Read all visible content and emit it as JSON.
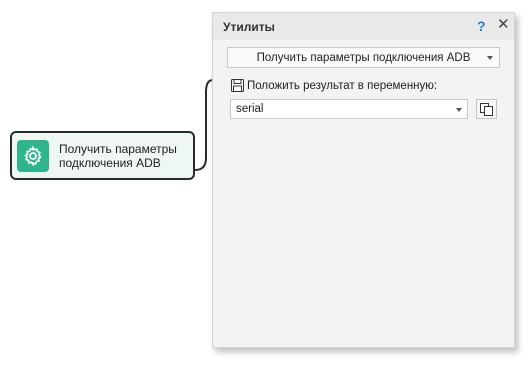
{
  "node": {
    "label": "Получить параметры\nподключения ADB",
    "icon": "gear-icon",
    "accent_color": "#2fb58c"
  },
  "panel": {
    "title": "Утилиты",
    "help_label": "?",
    "close_label": "✕",
    "action_value": "Получить параметры подключения ADB",
    "result_label": "Положить результат в переменную:",
    "variable_value": "serial",
    "accent_color": "#1e7fd0"
  }
}
